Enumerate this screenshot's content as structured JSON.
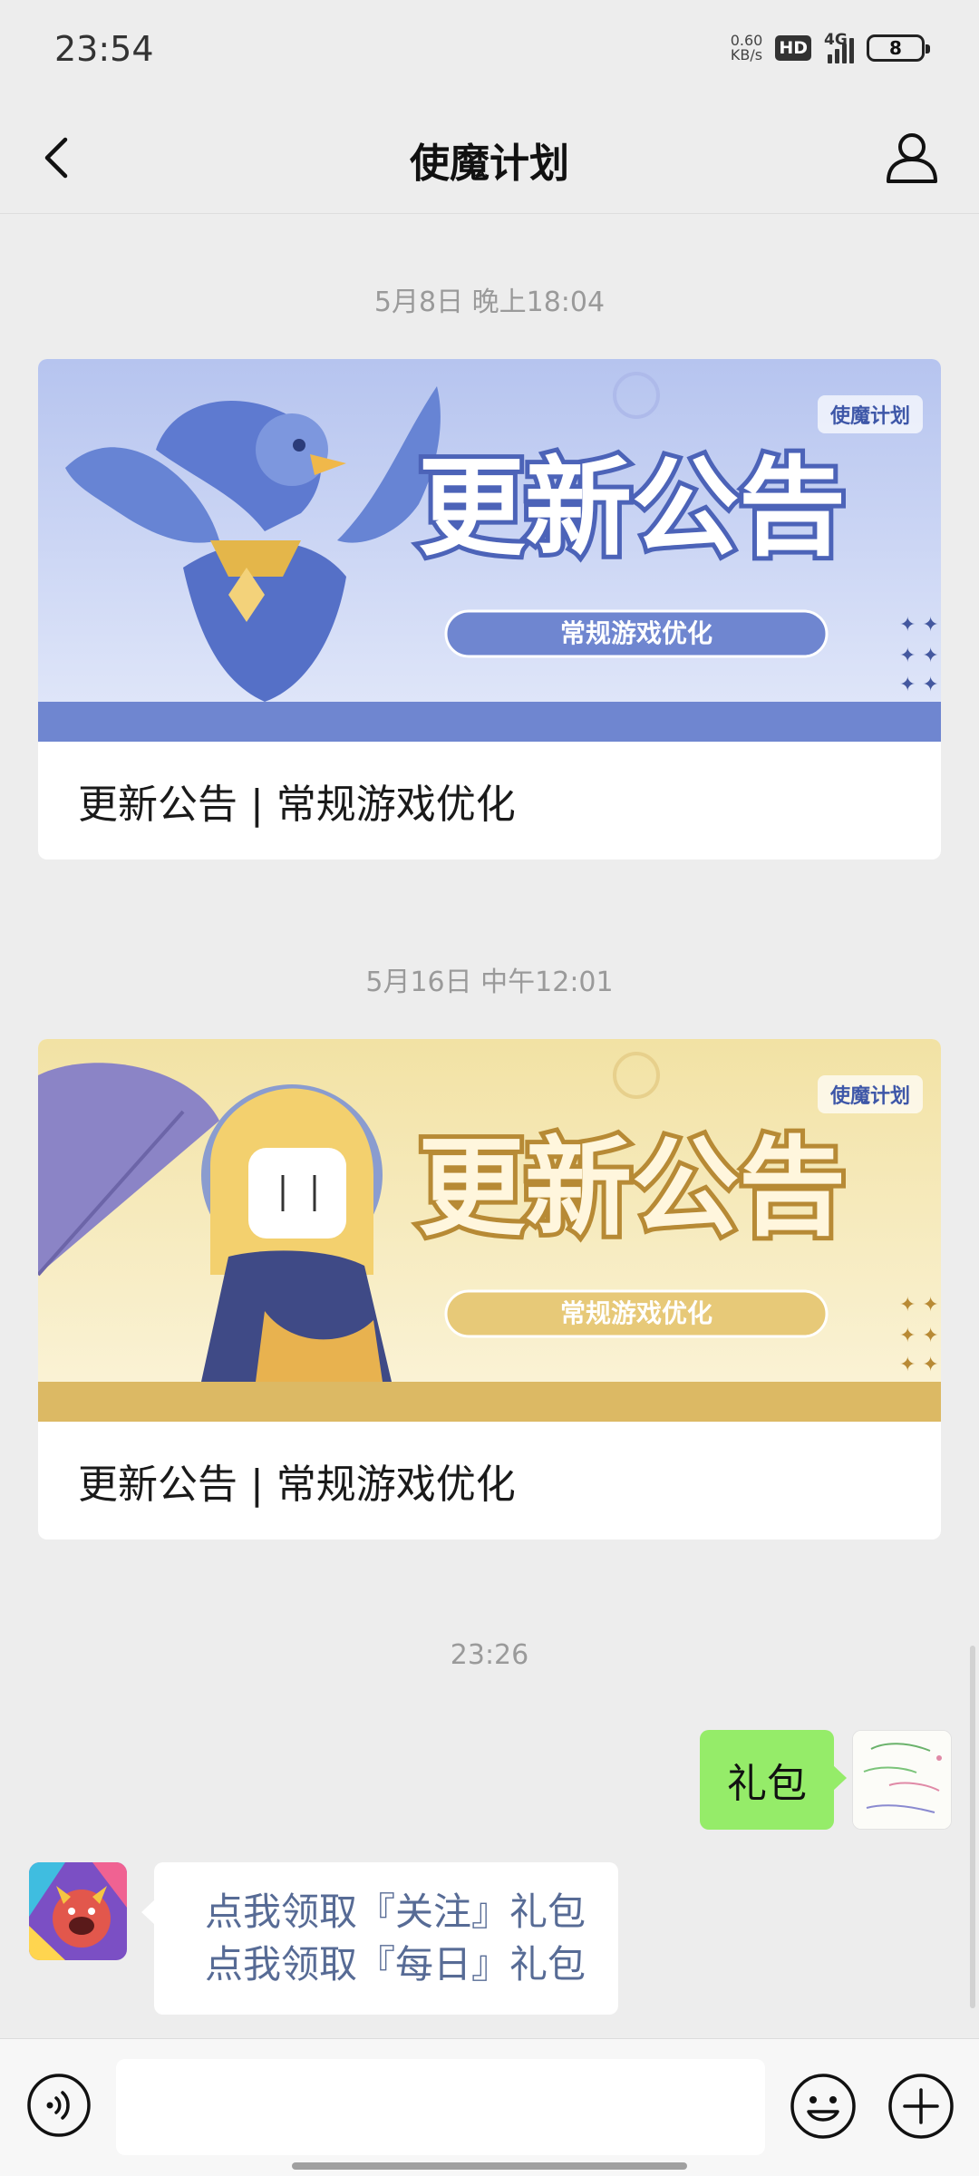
{
  "status_bar": {
    "time": "23:54",
    "net_speed_value": "0.60",
    "net_speed_unit": "KB/s",
    "hd_label": "HD",
    "network_label": "4G",
    "battery_level": "8"
  },
  "nav": {
    "title": "使魔计划"
  },
  "messages": [
    {
      "timestamp": "5月8日 晚上18:04",
      "banner_title": "更新公告",
      "banner_subtitle": "常规游戏优化",
      "banner_logo": "使魔计划",
      "caption": "更新公告 | 常规游戏优化",
      "theme": "blue"
    },
    {
      "timestamp": "5月16日 中午12:01",
      "banner_title": "更新公告",
      "banner_subtitle": "常规游戏优化",
      "banner_logo": "使魔计划",
      "caption": "更新公告 | 常规游戏优化",
      "theme": "gold"
    }
  ],
  "chat": {
    "timestamp": "23:26",
    "outgoing_text": "礼包",
    "incoming_links": [
      "点我领取『关注』礼包",
      "点我领取『每日』礼包"
    ]
  },
  "colors": {
    "background": "#ededed",
    "outgoing_bubble": "#95ec69",
    "link": "#576b95",
    "blue_banner": "#8fa6e6",
    "gold_banner": "#f0dfa0"
  },
  "icons": {
    "back": "chevron-left-icon",
    "profile": "person-icon",
    "voice": "voice-icon",
    "emoji": "emoji-icon",
    "plus": "plus-icon"
  }
}
